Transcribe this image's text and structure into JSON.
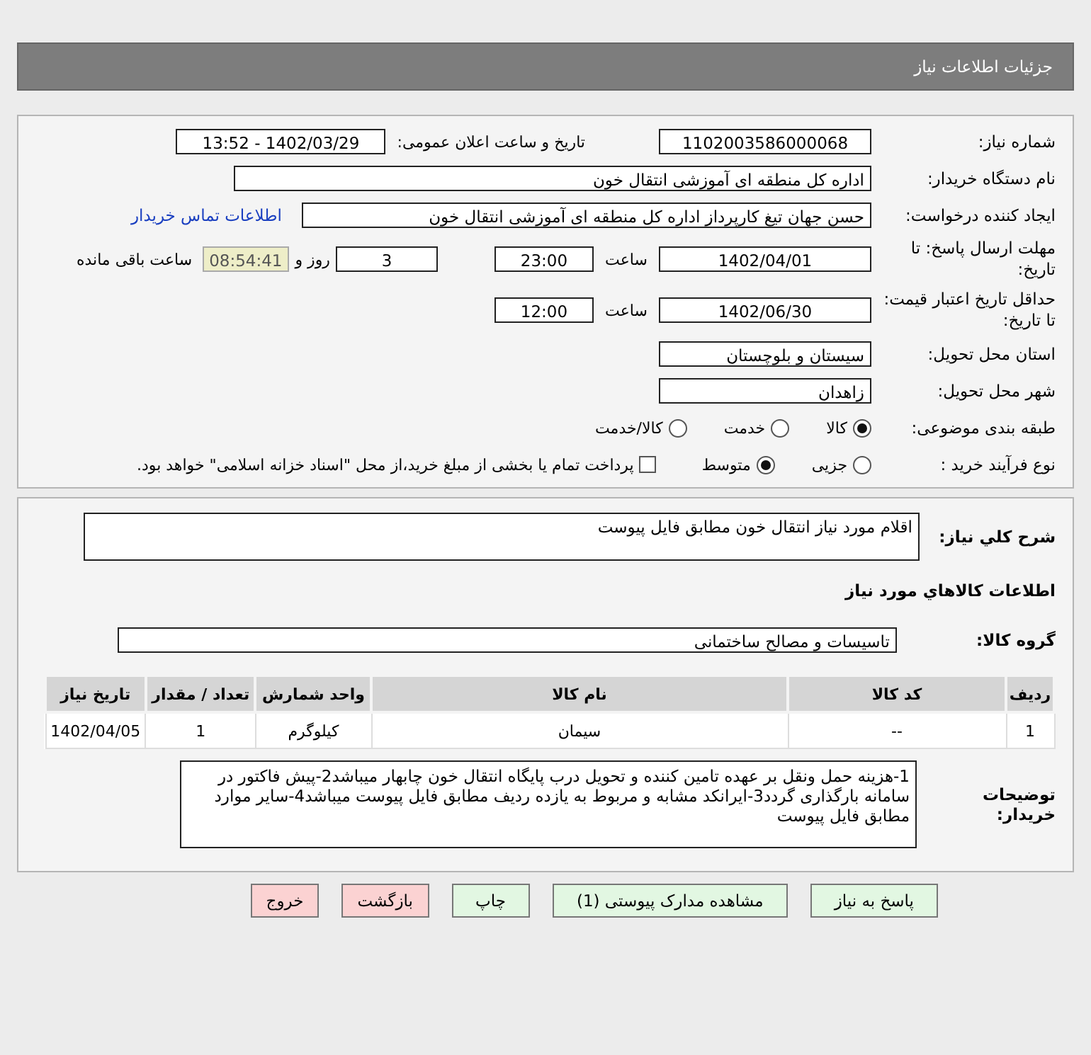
{
  "header": {
    "title": "جزئیات اطلاعات نیاز"
  },
  "need_number": {
    "label": "شماره نیاز:",
    "value": "1102003586000068"
  },
  "announce": {
    "label": "تاریخ و ساعت اعلان عمومی:",
    "value": "1402/03/29 - 13:52"
  },
  "buyer_org": {
    "label": "نام دستگاه خریدار:",
    "value": "اداره کل منطقه ای آموزشی انتقال خون"
  },
  "requester": {
    "label": "ایجاد کننده درخواست:",
    "value": "حسن جهان تیغ کارپرداز اداره کل منطقه ای آموزشی انتقال خون",
    "link": "اطلاعات تماس خریدار"
  },
  "deadline": {
    "label": "مهلت ارسال پاسخ: تا تاریخ:",
    "date": "1402/04/01",
    "time_label": "ساعت",
    "time": "23:00",
    "days": "3",
    "days_label": "روز و",
    "remaining": "08:54:41",
    "remaining_label": "ساعت باقی مانده"
  },
  "validity": {
    "label": "حداقل تاریخ اعتبار قیمت: تا تاریخ:",
    "date": "1402/06/30",
    "time_label": "ساعت",
    "time": "12:00"
  },
  "province": {
    "label": "استان محل تحویل:",
    "value": "سیستان و بلوچستان"
  },
  "city": {
    "label": "شهر محل تحویل:",
    "value": "زاهدان"
  },
  "category": {
    "label": "طبقه بندی موضوعی:",
    "options": [
      {
        "label": "کالا",
        "selected": true
      },
      {
        "label": "خدمت",
        "selected": false
      },
      {
        "label": "کالا/خدمت",
        "selected": false
      }
    ]
  },
  "process": {
    "label": "نوع فرآیند خرید :",
    "options": [
      {
        "label": "جزیی",
        "selected": false
      },
      {
        "label": "متوسط",
        "selected": true
      }
    ],
    "payment": {
      "checked": false,
      "text": "پرداخت تمام یا بخشی از مبلغ خرید،از محل \"اسناد خزانه اسلامی\" خواهد بود."
    }
  },
  "description": {
    "label": "شرح کلي نياز:",
    "value": "اقلام مورد نیاز انتقال خون مطابق فایل پیوست"
  },
  "goods_heading": "اطلاعات کالاهاي مورد نياز",
  "goods_group": {
    "label": "گروه کالا:",
    "value": "تاسیسات و مصالح ساختمانی"
  },
  "table": {
    "columns": [
      "ردیف",
      "کد کالا",
      "نام کالا",
      "واحد شمارش",
      "تعداد / مقدار",
      "تاریخ نیاز"
    ],
    "rows": [
      [
        "1",
        "--",
        "سیمان",
        "کیلوگرم",
        "1",
        "1402/04/05"
      ]
    ]
  },
  "buyer_notes": {
    "label": "توضیحات خریدار:",
    "value": "1-هزینه حمل ونقل بر عهده تامین کننده و تحویل درب پایگاه انتقال خون چابهار میباشد2-پیش فاکتور در سامانه بارگذاری گردد3-ایرانکد مشابه و مربوط به یازده ردیف مطابق فایل پیوست میباشد4-سایر موارد مطابق فایل پیوست"
  },
  "buttons": [
    {
      "label": "پاسخ به نیاز",
      "kind": "normal"
    },
    {
      "label": "مشاهده مدارک پیوستی (1)",
      "kind": "normal"
    },
    {
      "label": "چاپ",
      "kind": "normal"
    },
    {
      "label": "بازگشت",
      "kind": "danger"
    },
    {
      "label": "خروج",
      "kind": "danger"
    }
  ]
}
